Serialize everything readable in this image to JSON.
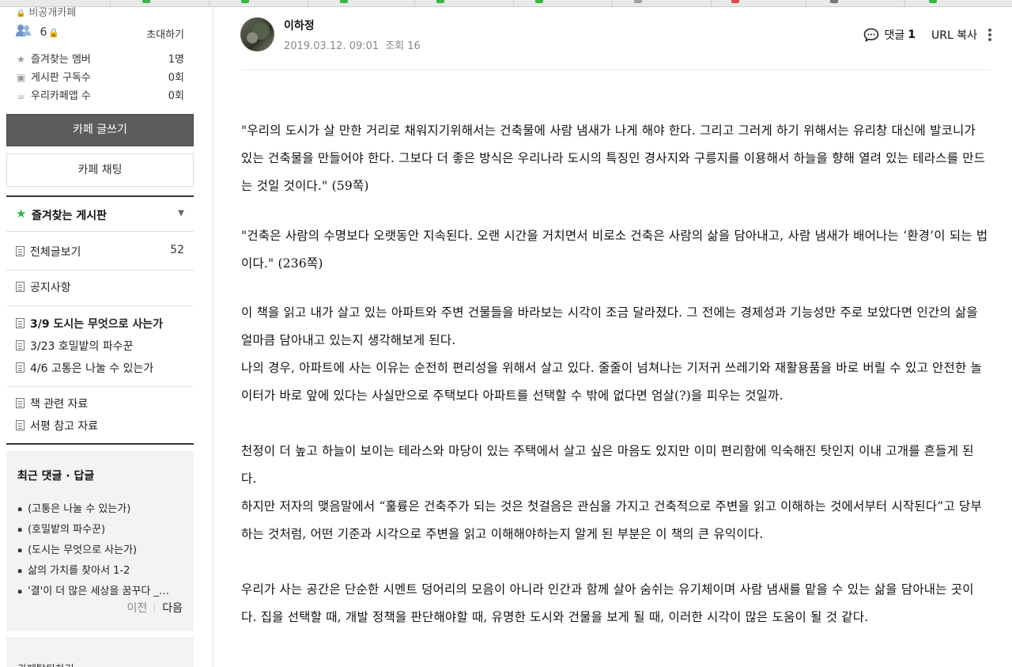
{
  "sidebar": {
    "cafe_type": "비공개카페",
    "member_count": "6",
    "invite_label": "초대하기",
    "stats": [
      {
        "icon": "star-icon",
        "label": "즐겨찾는 멤버",
        "value": "1명"
      },
      {
        "icon": "rss-icon",
        "label": "게시판 구독수",
        "value": "0회"
      },
      {
        "icon": "app-icon",
        "label": "우리카페앱 수",
        "value": "0회"
      }
    ],
    "write_button": "카페 글쓰기",
    "chat_button": "카페 채팅",
    "favorites_label": "즐겨찾는 게시판",
    "menu": {
      "all_posts": {
        "label": "전체글보기",
        "count": "52"
      },
      "notice": {
        "label": "공지사항"
      },
      "boards": [
        {
          "label": "3/9 도시는 무엇으로 사는가"
        },
        {
          "label": "3/23 호밀밭의 파수꾼"
        },
        {
          "label": "4/6 고통은 나눌 수 있는가"
        }
      ],
      "resources": [
        {
          "label": "책 관련 자료"
        },
        {
          "label": "서평 참고 자료"
        }
      ]
    },
    "recent": {
      "title": "최근 댓글 · 답글",
      "items": [
        "(고통은 나눌 수 있는가)",
        "(호밀밭의 파수꾼)",
        "(도시는 무엇으로 사는가)",
        "삶의 가치를 찾아서 1-2",
        "'결'이 더 많은 세상을 꿈꾸다 _…"
      ],
      "prev": "이전",
      "next": "다음"
    },
    "bottom_label": "카페탈퇴하기"
  },
  "post": {
    "author": "이하정",
    "date": "2019.03.12. 09:01",
    "views": "조회 16",
    "comment_label": "댓글",
    "comment_count": "1",
    "url_copy": "URL 복사",
    "paragraphs": [
      "\"우리의 도시가 살 만한 거리로 채워지기위해서는 건축물에 사람 냄새가 나게 해야 한다. 그리고 그러게 하기 위해서는 유리창 대신에 발코니가 있는 건축물을 만들어야 한다. 그보다 더 좋은 방식은 우리나라 도시의 특징인 경사지와 구릉지를 이용해서 하늘을 향해 열려 있는 테라스를 만드는 것일 것이다.\" (59쪽)",
      "\"건축은 사람의 수명보다 오랫동안 지속된다. 오랜 시간을 거치면서 비로소 건축은 사람의 삶을 담아내고, 사람 냄새가 배어나는 ‘환경’이 되는 법이다.\" (236쪽)",
      " 이 책을 읽고 내가 살고 있는 아파트와 주변 건물들을 바라보는 시각이 조금 달라졌다. 그 전에는 경제성과 기능성만 주로 보았다면 인간의 삶을 얼마큼 담아내고 있는지 생각해보게 된다.",
      " 나의 경우, 아파트에 사는 이유는 순전히 편리성을 위해서 살고 있다. 줄줄이 넘쳐나는 기저귀 쓰레기와 재활용품을 바로 버릴 수 있고 안전한 놀이터가 바로 앞에 있다는 사실만으로 주택보다 아파트를 선택할 수 밖에 없다면 엄살(?)을 피우는 것일까.",
      " 천정이 더 높고 하늘이 보이는 테라스와 마당이 있는 주택에서 살고 싶은 마음도 있지만 이미 편리함에 익숙해진 탓인지 이내 고개를 흔들게 된다.",
      " 하지만 저자의 맺음말에서 “훌륭은 건축주가 되는 것은 첫걸음은 관심을 가지고 건축적으로 주변을 읽고 이해하는 것에서부터 시작된다”고 당부하는 것처럼, 어떤 기준과 시각으로 주변을 읽고 이해해야하는지 알게 된 부분은 이 책의 큰 유익이다.",
      " 우리가 사는 공간은 단순한 시멘트 덩어리의 모음이 아니라 인간과 함께 살아 숨쉬는 유기체이며 사람 냄새를 맡을 수 있는 삶을 담아내는 곳이다. 집을 선택할 때, 개발 정책을 판단해야할 때, 유명한 도시와 건물을 보게 될 때, 이러한 시각이 많은 도움이 될 것 같다."
    ]
  },
  "colors": {
    "accent_green": "#2fb73f",
    "write_button_bg": "#5c5c5c",
    "member_icon": "#6f93c6"
  }
}
